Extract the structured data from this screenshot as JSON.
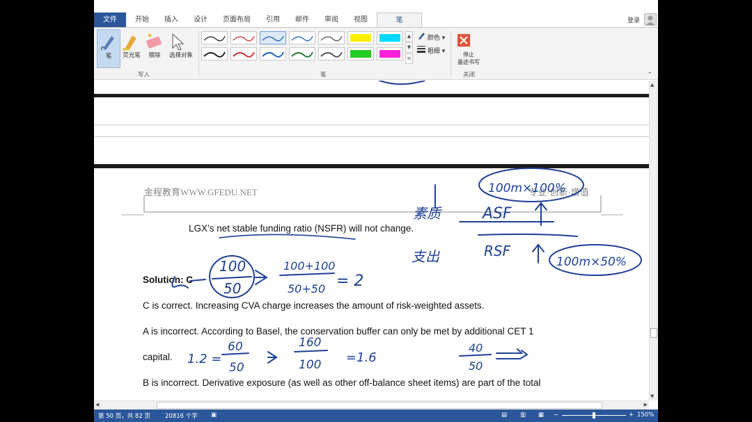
{
  "tabs": {
    "file": "文件",
    "home": "开始",
    "insert": "插入",
    "design": "设计",
    "layout": "页面布局",
    "references": "引用",
    "mailings": "邮件",
    "review": "审阅",
    "view": "视图",
    "pen": "笔"
  },
  "account": {
    "login": "登录"
  },
  "ribbon": {
    "write_group": {
      "pen": "笔",
      "highlighter": "荧光笔",
      "eraser": "擦除",
      "select": "选择对象",
      "label": "写入"
    },
    "pens_group": {
      "label": "笔",
      "color": "颜色",
      "thickness": "粗细"
    },
    "close_group": {
      "stop_line1": "停止",
      "stop_line2": "墨迹书写",
      "label": "关闭"
    }
  },
  "pen_colors": [
    "#222222",
    "#d32f2f",
    "#1f5fbf",
    "#1e7d3a",
    "#555555",
    "#ffee00",
    "#00d8ff",
    "#22cc22",
    "#ff22dd"
  ],
  "document": {
    "header_left": "金程教育WWW.GFEDU.NET",
    "header_right": "专业·创新·增值",
    "line1": "LGX’s net stable funding ratio (NSFR) will not change.",
    "solution": "Solution: C",
    "line_c": "C is correct. Increasing CVA charge increases the amount of risk-weighted assets.",
    "line_a": "A is incorrect. According to Basel, the conservation buffer can only be met by additional CET 1",
    "line_capital": "capital.",
    "line_b": "B is incorrect. Derivative exposure (as well as other off-balance sheet items) are part of the total"
  },
  "ink": {
    "frac1_num": "100",
    "frac1_den": "50",
    "frac2_num": "100+100",
    "frac2_den": "50+50",
    "result1": "= 2",
    "asf": "ASF",
    "rsf": "RSF",
    "asf_note": "100m×100%",
    "rsf_note": "100m×50%",
    "cn1": "素质",
    "cn2": "支出",
    "row2_lhs": "1.2 =",
    "row2_num": "60",
    "row2_den": "50",
    "row2_num2": "160",
    "row2_den2": "100",
    "row2_res": "=1.6",
    "row2_num3": "40",
    "row2_den3": "50"
  },
  "status": {
    "page": "第 50 页，共 82 页",
    "words": "20816 个字",
    "zoom": "150%"
  }
}
